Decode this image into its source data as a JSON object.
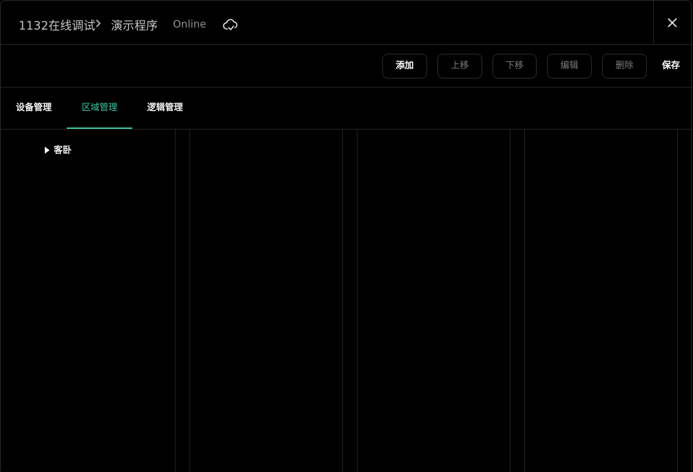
{
  "header": {
    "project": "1132在线调试",
    "program": "演示程序",
    "status": "Online"
  },
  "toolbar": {
    "add_label": "添加",
    "up_label": "上移",
    "down_label": "下移",
    "edit_label": "编辑",
    "delete_label": "删除",
    "save_label": "保存"
  },
  "tabs": [
    {
      "label": "设备管理",
      "active": false
    },
    {
      "label": "区域管理",
      "active": true
    },
    {
      "label": "逻辑管理",
      "active": false
    }
  ],
  "tree": {
    "items": [
      {
        "label": "客卧",
        "expanded": false
      }
    ]
  },
  "colors": {
    "background": "#000000",
    "accent": "#3fc6a6",
    "border": "#262626",
    "text": "#f2f2f2",
    "muted": "#7a7a7a"
  }
}
